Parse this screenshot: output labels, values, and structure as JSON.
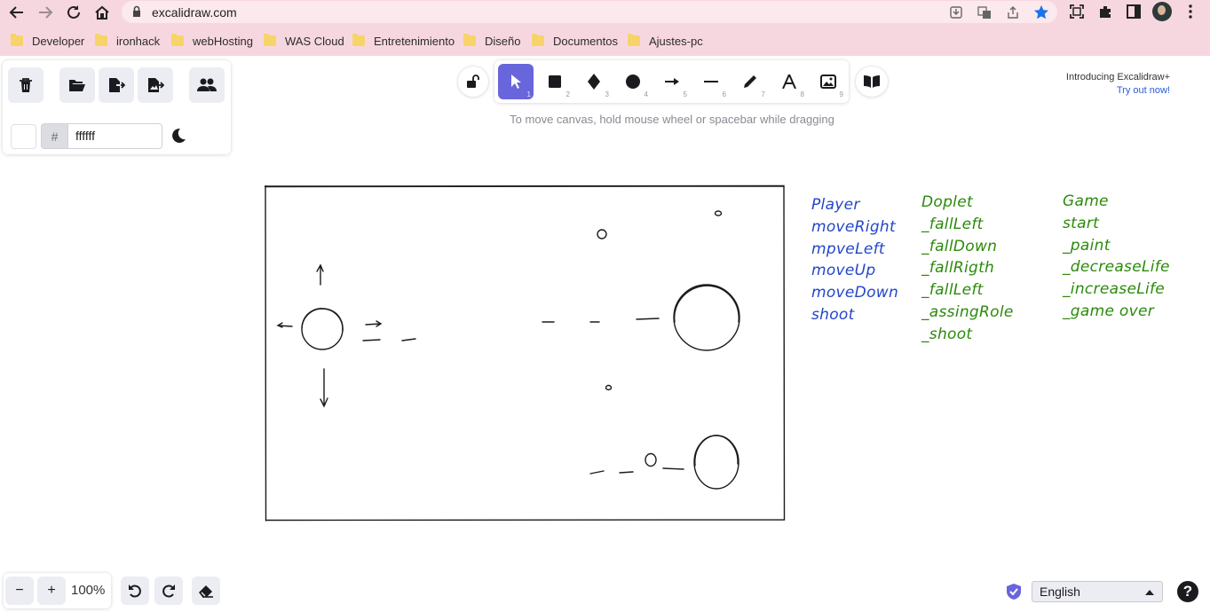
{
  "browser": {
    "url": "excalidraw.com",
    "bookmarks": [
      "Developer",
      "ironhack",
      "webHosting",
      "WAS Cloud",
      "Entretenimiento",
      "Diseño",
      "Documentos",
      "Ajustes-pc"
    ]
  },
  "menu": {
    "color_hash": "#",
    "background_hex": "ffffff",
    "background_color": "#ffffff"
  },
  "toolbar": {
    "tool_numbers": [
      "1",
      "2",
      "3",
      "4",
      "5",
      "6",
      "7",
      "8",
      "9"
    ],
    "active_tool": "selection",
    "accent_color": "#6965db"
  },
  "hint": "To move canvas, hold mouse wheel or spacebar while dragging",
  "promo": {
    "line1": "Introducing Excalidraw+",
    "line2": "Try out now!"
  },
  "notes": {
    "player": [
      "Player",
      "moveRight",
      "mpveLeft",
      "moveUp",
      "moveDown",
      "shoot"
    ],
    "doplet": [
      "Doplet",
      "_fallLeft",
      "_fallDown",
      "_fallRigth",
      "_fallLeft",
      "_assingRole",
      "_shoot"
    ],
    "game": [
      "Game",
      "start",
      "_paint",
      "_decreaseLife",
      "_increaseLife",
      "_game over"
    ],
    "colors": {
      "player": "#2346c9",
      "doplet": "#2b8a0a",
      "game": "#2b8a0a"
    }
  },
  "footer": {
    "zoom_out": "−",
    "zoom_in": "+",
    "zoom": "100%",
    "language": "English",
    "help": "?"
  }
}
